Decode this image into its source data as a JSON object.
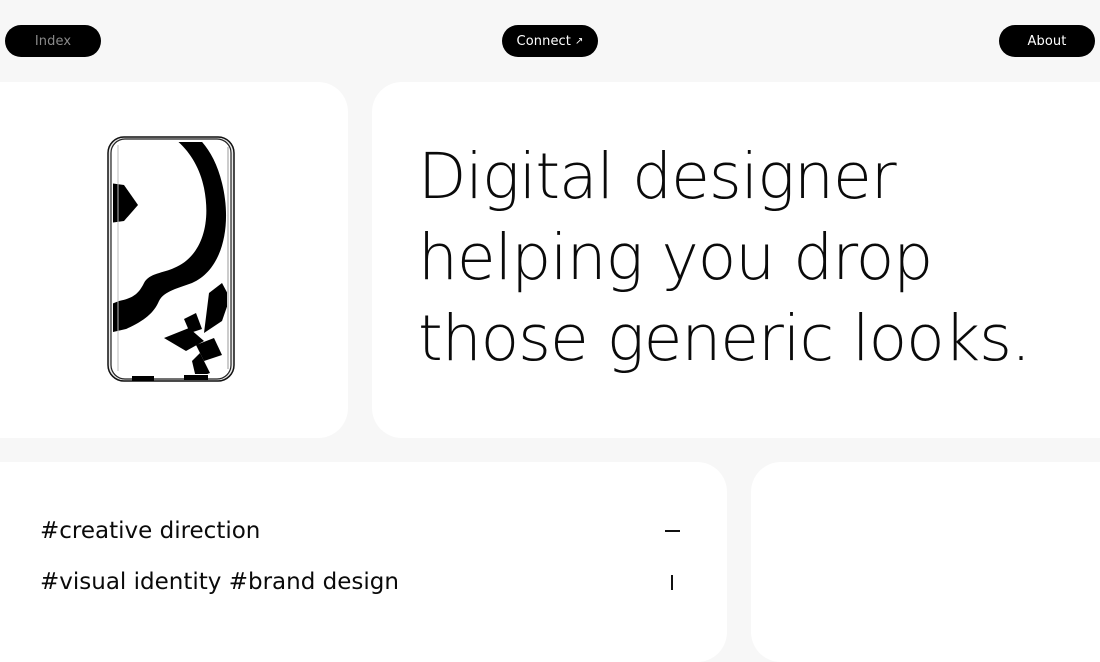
{
  "nav": {
    "index_label": "Index",
    "connect_label": "Connect",
    "connect_arrow": "↗",
    "about_label": "About"
  },
  "hero": {
    "lines": [
      "Digital designer",
      "helping you drop",
      "those generic looks."
    ]
  },
  "tags": {
    "items": [
      {
        "label": "#creative direction",
        "state": "expanded"
      },
      {
        "label": "#visual identity #brand design",
        "state": "collapsed"
      }
    ]
  },
  "icons": {
    "phone_art": "abstract-phone-illustration-icon",
    "minus": "minus-icon",
    "bar": "plus-partial-icon"
  },
  "colors": {
    "background": "#f7f7f7",
    "card": "#ffffff",
    "pill": "#000000",
    "text": "#0a0a0a",
    "index_text": "#8a8a8a"
  }
}
